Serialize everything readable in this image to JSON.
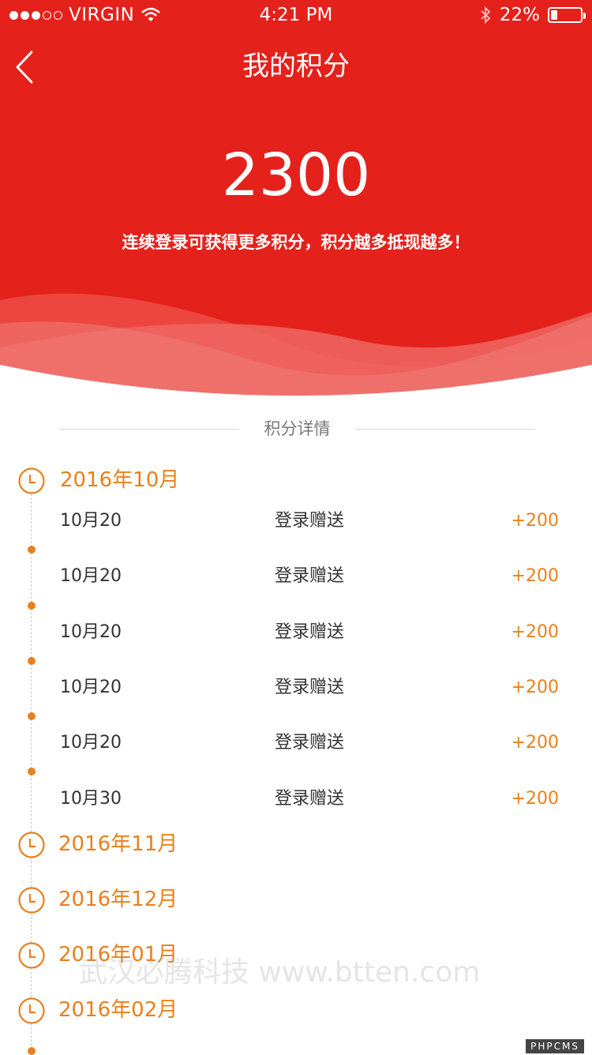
{
  "status_bar": {
    "carrier": "VIRGIN",
    "time": "4:21 PM",
    "battery": "22%",
    "signal_full": 3,
    "signal_empty": 2,
    "icons": [
      "wifi-icon",
      "bluetooth-icon",
      "battery-icon"
    ]
  },
  "nav": {
    "title": "我的积分",
    "back_icon": "chevron-left-icon"
  },
  "points": {
    "value": "2300",
    "tip": "连续登录可获得更多积分，积分越多抵现越多！"
  },
  "section": {
    "title": "积分详情"
  },
  "timeline": {
    "months": [
      {
        "label": "2016年10月",
        "records": [
          {
            "date": "10月20",
            "desc": "登录赠送",
            "amount": "+200"
          },
          {
            "date": "10月20",
            "desc": "登录赠送",
            "amount": "+200"
          },
          {
            "date": "10月20",
            "desc": "登录赠送",
            "amount": "+200"
          },
          {
            "date": "10月20",
            "desc": "登录赠送",
            "amount": "+200"
          },
          {
            "date": "10月20",
            "desc": "登录赠送",
            "amount": "+200"
          },
          {
            "date": "10月30",
            "desc": "登录赠送",
            "amount": "+200"
          }
        ]
      },
      {
        "label": "2016年11月"
      },
      {
        "label": "2016年12月"
      },
      {
        "label": "2016年01月"
      },
      {
        "label": "2016年02月"
      }
    ]
  },
  "watermark": "武汉必腾科技 www.btten.com",
  "corner_tag": "PHPCMS",
  "colors": {
    "header": "#e5211c",
    "accent": "#e8801e",
    "text": "#333333"
  }
}
